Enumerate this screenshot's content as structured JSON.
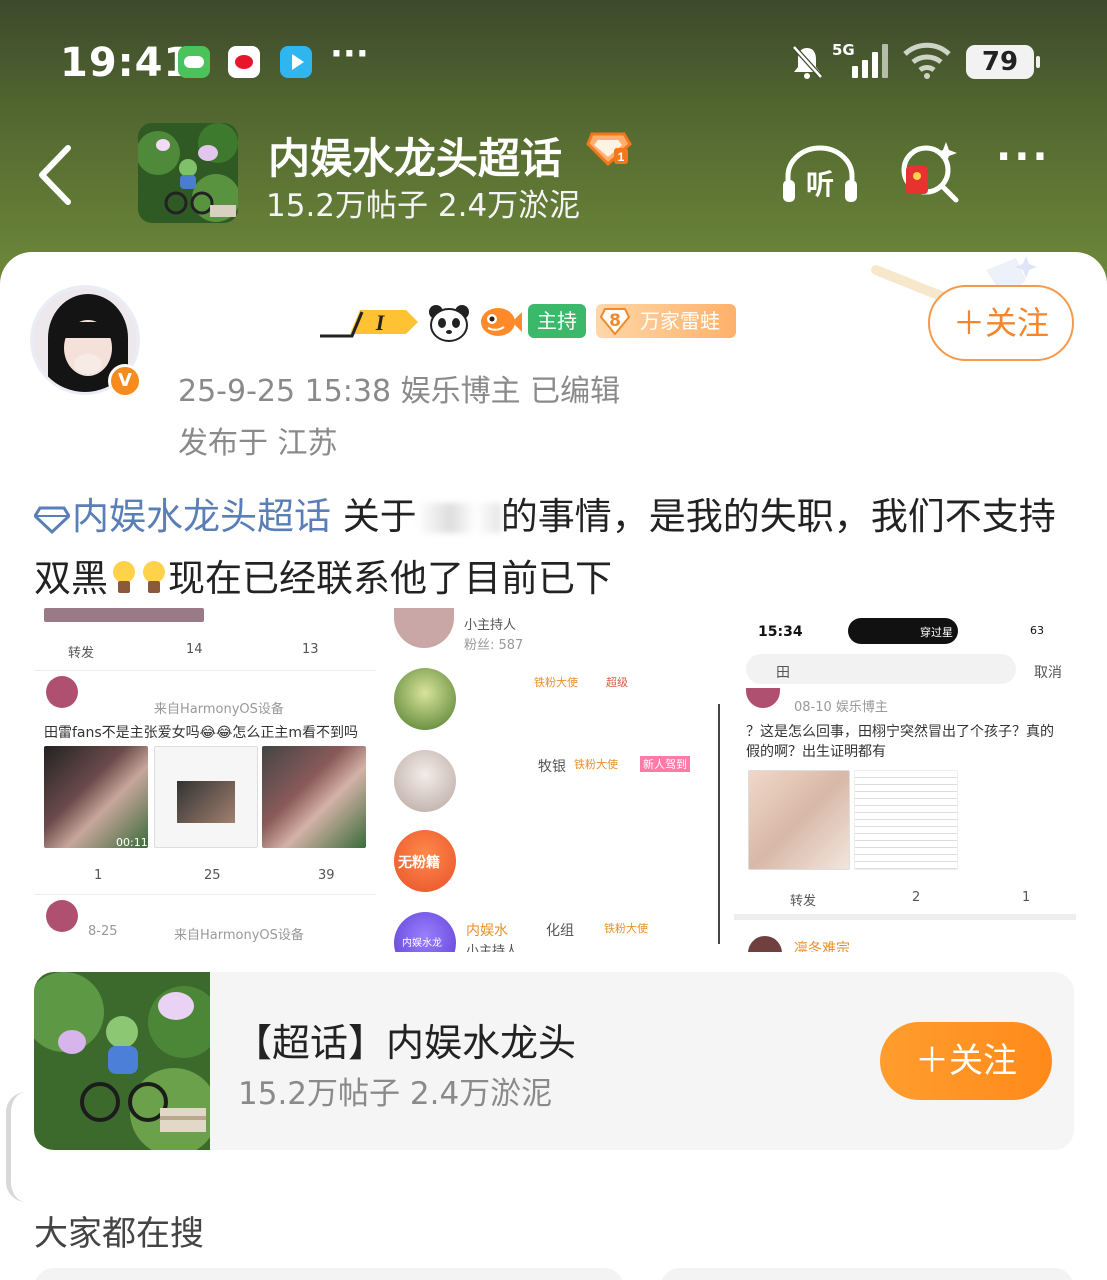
{
  "status_bar": {
    "time": "19:41",
    "more": "···",
    "network": "5G",
    "battery": "79",
    "icons": [
      "game-app-icon",
      "weibo-app-icon",
      "video-app-icon",
      "mute-icon",
      "signal-icon",
      "wifi-icon",
      "battery-icon"
    ]
  },
  "header": {
    "title": "内娱水龙头超话",
    "stats": "15.2万帖子 2.4万淤泥",
    "listen_label": "听",
    "more": "···"
  },
  "post": {
    "badges": {
      "rank": "I",
      "host": "主持",
      "fan_level": "8",
      "fan_name": "万家雷蛙"
    },
    "follow_label": "＋关注",
    "meta": "25-9-25 15:38  娱乐博主  已编辑",
    "location": "发布于 江苏",
    "tag": "内娱水龙头超话",
    "text_part1": "  关于",
    "text_part2": "的事情，是我的失职，我们不支持双黑",
    "text_part3": "现在已经联系他了目前已下"
  },
  "embedded": {
    "shot1": {
      "repost": "转发",
      "comments1": "14",
      "likes1": "13",
      "device": "来自HarmonyOS设备",
      "comment_text": "田雷fans不是主张爱女吗😂😂怎么正主m看不到吗",
      "duration": "00:11",
      "repost2": "1",
      "comments2": "25",
      "likes2": "39",
      "date2": "8-25",
      "device2": "来自HarmonyOS设备"
    },
    "shot2": {
      "role1": "小主持人",
      "count1": "粉丝: 587",
      "label1": "牧银",
      "badge1": "铁粉大使",
      "badge2": "新人驾到",
      "badge3": "铁粉大使",
      "badge4": "超级",
      "avatar_text1": "无粉籍",
      "name4": "内娱水",
      "role4": "小主持人",
      "label4": "化组",
      "badge5": "铁粉大使",
      "avatar_text2": "内娱水龙"
    },
    "shot3": {
      "time": "15:34",
      "island": "穿过星",
      "battery": "63",
      "search_value": "田",
      "cancel": "取消",
      "meta": "08-10  娱乐博主",
      "text": "？这是怎么回事，田栩宁突然冒出了个孩子？真的假的啊？出生证明都有",
      "repost": "转发",
      "comments": "2",
      "likes": "1",
      "next_user": "凛冬难宗"
    }
  },
  "topic_card": {
    "name": "【超话】内娱水龙头",
    "stats": "15.2万帖子 2.4万淤泥",
    "follow_label": "＋关注"
  },
  "section": {
    "title": "大家都在搜"
  },
  "colors": {
    "accent_orange": "#ff8a1a",
    "tag_blue": "#5a7eb6",
    "header_green": "#556b31"
  }
}
